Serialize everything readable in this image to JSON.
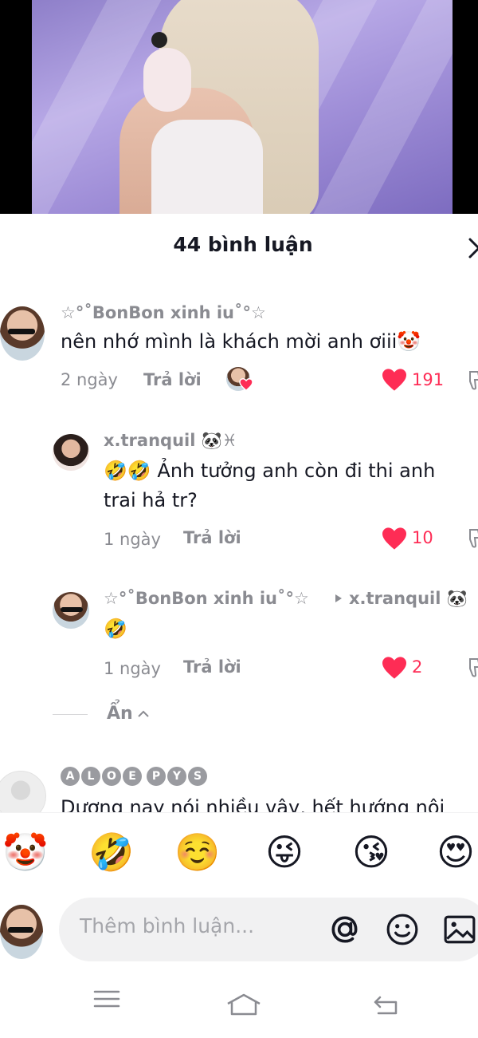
{
  "header": {
    "title": "44 bình luận"
  },
  "comments": [
    {
      "username": "☆°˚BonBon xinh iu˚°☆",
      "text": "nên nhớ mình là khách mời anh ơiii🤡",
      "time": "2 ngày",
      "reply_label": "Trả lời",
      "likes": "191"
    },
    {
      "username": "x.tranquil 🐼♓",
      "text": "🤣🤣 Ảnh tưởng anh còn đi thi anh trai hả tr?",
      "time": "1 ngày",
      "reply_label": "Trả lời",
      "likes": "10"
    },
    {
      "username": "☆°˚BonBon xinh iu˚°☆",
      "reply_to": "x.tranquil 🐼",
      "text": "🤣",
      "time": "1 ngày",
      "reply_label": "Trả lời",
      "likes": "2"
    },
    {
      "username_letters": [
        "A",
        "L",
        "O",
        "E",
        "P",
        "Y",
        "S"
      ],
      "text": "Dương nay nói nhiều vậy, hết hướng nội"
    }
  ],
  "hide_replies_label": "Ẩn",
  "emoji_bar": [
    "🤡",
    "🤣",
    "☺️",
    "😜",
    "😘",
    "😍"
  ],
  "input": {
    "placeholder": "Thêm bình luận..."
  },
  "colors": {
    "like": "#fe2c55",
    "muted": "#8a8b91"
  }
}
